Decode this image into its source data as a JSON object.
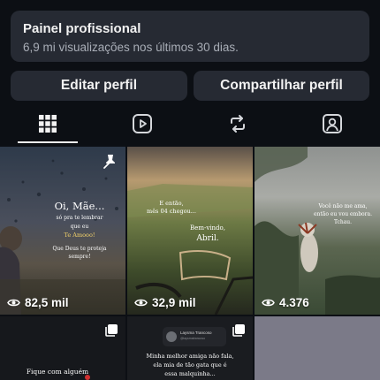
{
  "dashboard": {
    "title": "Painel profissional",
    "subtitle": "6,9 mi visualizações nos últimos 30 dias."
  },
  "buttons": {
    "edit_profile": "Editar perfil",
    "share_profile": "Compartilhar perfil"
  },
  "tabs": [
    {
      "name": "grid-icon",
      "active": true
    },
    {
      "name": "reels-icon",
      "active": false
    },
    {
      "name": "reposts-icon",
      "active": false
    },
    {
      "name": "tagged-icon",
      "active": false
    }
  ],
  "posts": [
    {
      "title": "Oi, Mãe...",
      "lines": [
        "só pra te lembrar",
        "que eu",
        "Te Amooo!",
        "Que Deus te proteja",
        "sempre!"
      ],
      "views": "82,5 mil",
      "pinned": true
    },
    {
      "lines": [
        "E então,",
        "mês 04 chegou..."
      ],
      "lines2": [
        "Bem-vindo,",
        "Abril."
      ],
      "views": "32,9 mil"
    },
    {
      "lines": [
        "Você não me ama,",
        "então eu vou embora.",
        "Tchau."
      ],
      "views": "4.376"
    },
    {
      "caption": "Fique com alguém",
      "multi": true
    },
    {
      "account_name": "Laysma Trancoso",
      "account_handle": "@laysmatrancoso",
      "lines": [
        "Minha melhor amiga não fala,",
        "ela mia de tão gata que é",
        "essa malquinha..."
      ],
      "multi": true
    },
    {}
  ],
  "colors": {
    "background": "#0c0f14",
    "card": "#262a33",
    "accent_text": "#f5d36a"
  }
}
